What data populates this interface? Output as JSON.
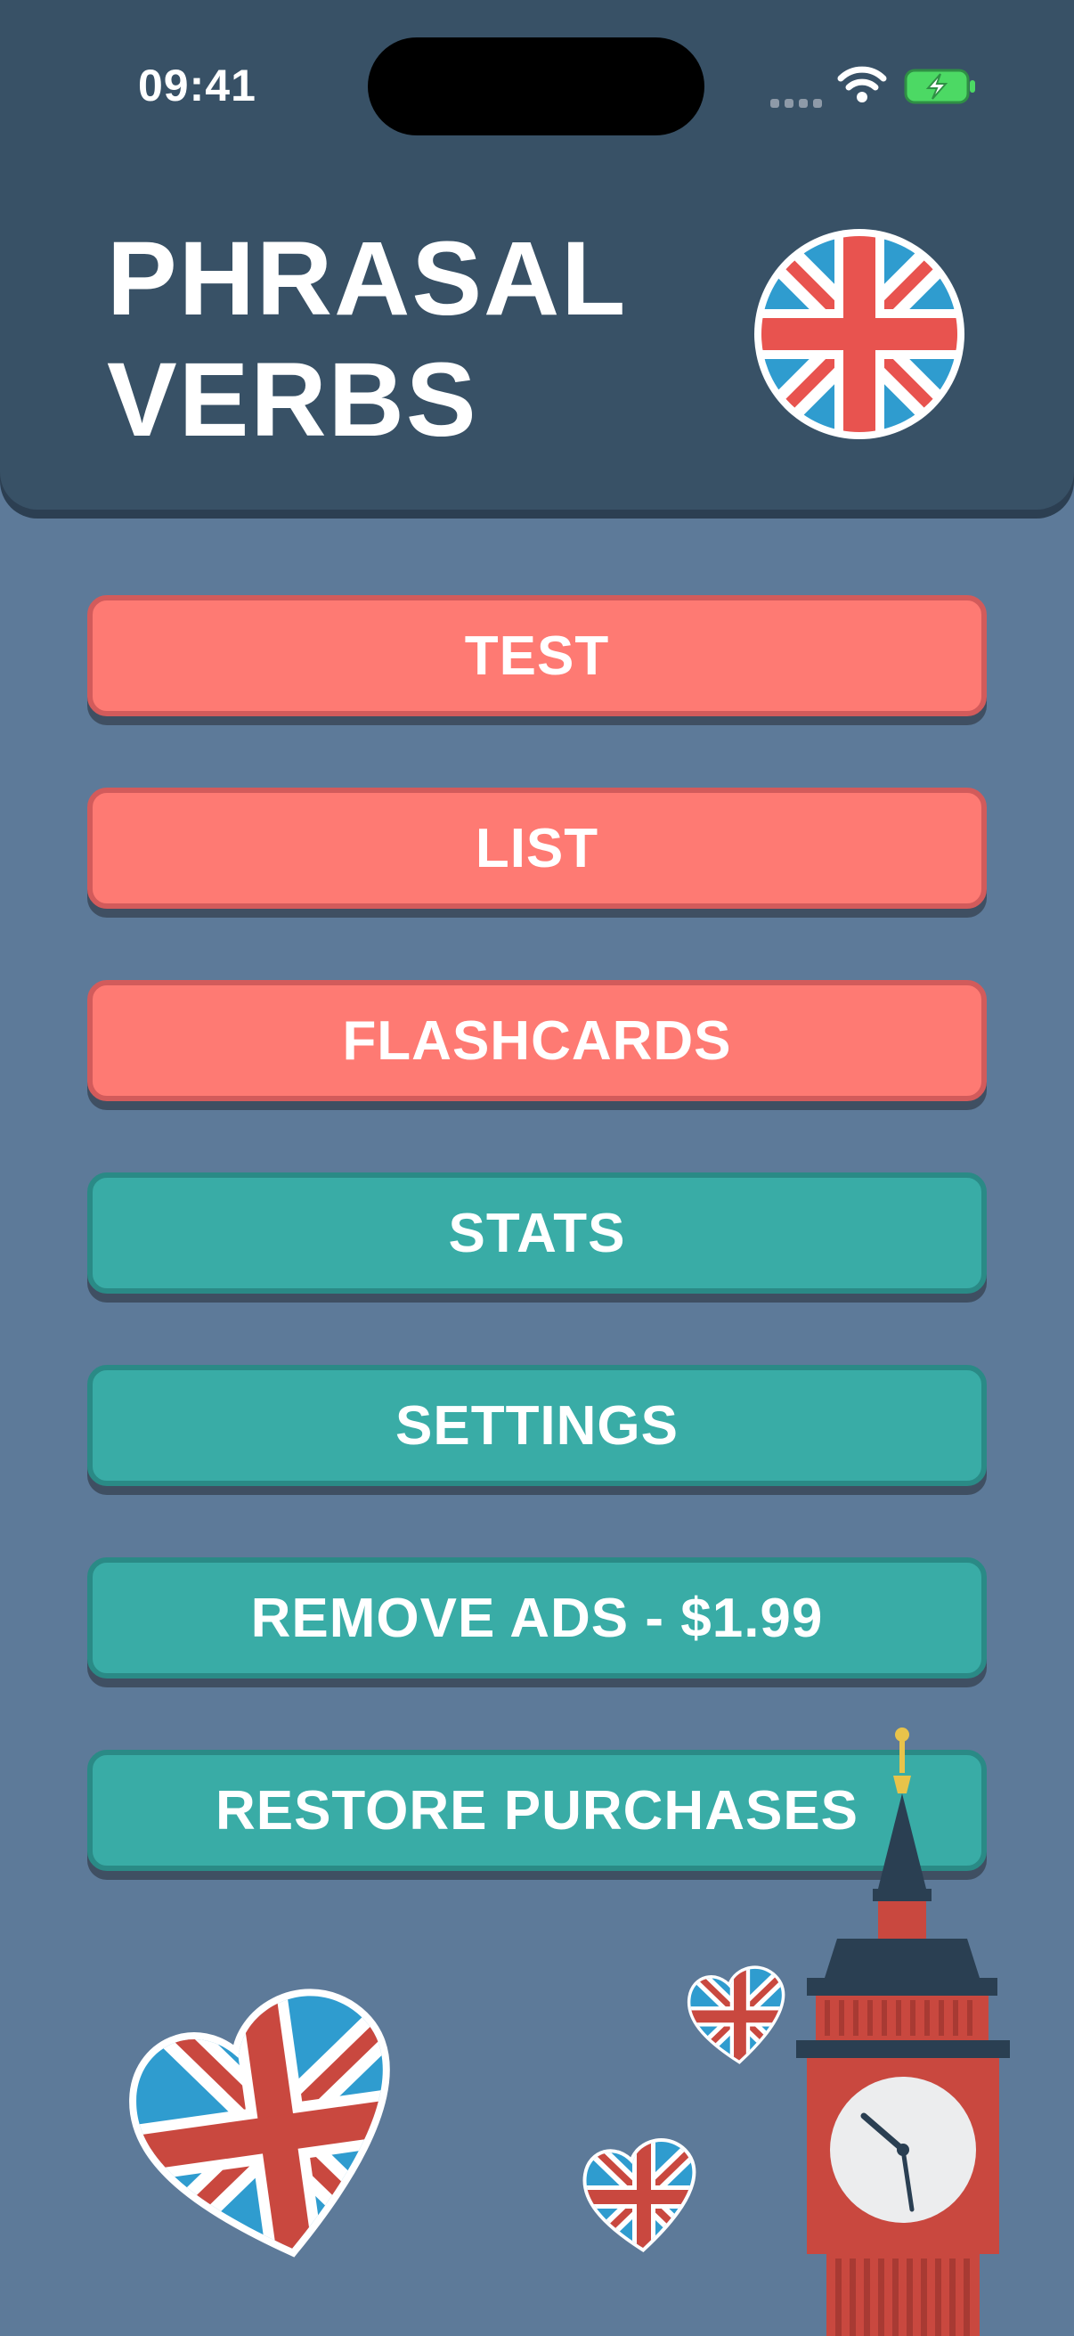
{
  "status_bar": {
    "time": "09:41"
  },
  "header": {
    "title_line1": "PHRASAL",
    "title_line2": "VERBS"
  },
  "menu": {
    "test": "TEST",
    "list": "LIST",
    "flashcards": "FLASHCARDS",
    "stats": "STATS",
    "settings": "SETTINGS",
    "remove_ads": "REMOVE ADS - $1.99",
    "restore_purchases": "RESTORE PURCHASES"
  },
  "colors": {
    "background": "#5d7a99",
    "header": "#385166",
    "button_red": "#fe7a73",
    "button_teal": "#39aca6",
    "flag_blue": "#2f9ccf",
    "flag_red": "#e8534f"
  },
  "icons": [
    "wifi-icon",
    "battery-charging-icon",
    "uk-flag-icon",
    "uk-heart-icon",
    "big-ben-icon"
  ]
}
